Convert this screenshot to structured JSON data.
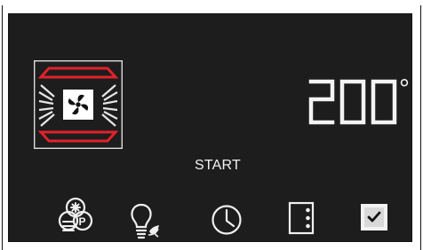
{
  "oven": {
    "temperature": "200",
    "degree_symbol": "°",
    "start_label": "START"
  },
  "icons": [
    "steam-proof-icon",
    "lamp-icon",
    "clock-icon",
    "menu-icon",
    "checkbox-icon"
  ],
  "colors": {
    "panel": "#1d1d1d",
    "display_text": "#f2f2f2",
    "heater_red": "#e1222b",
    "outline": "#d9d9d9"
  }
}
